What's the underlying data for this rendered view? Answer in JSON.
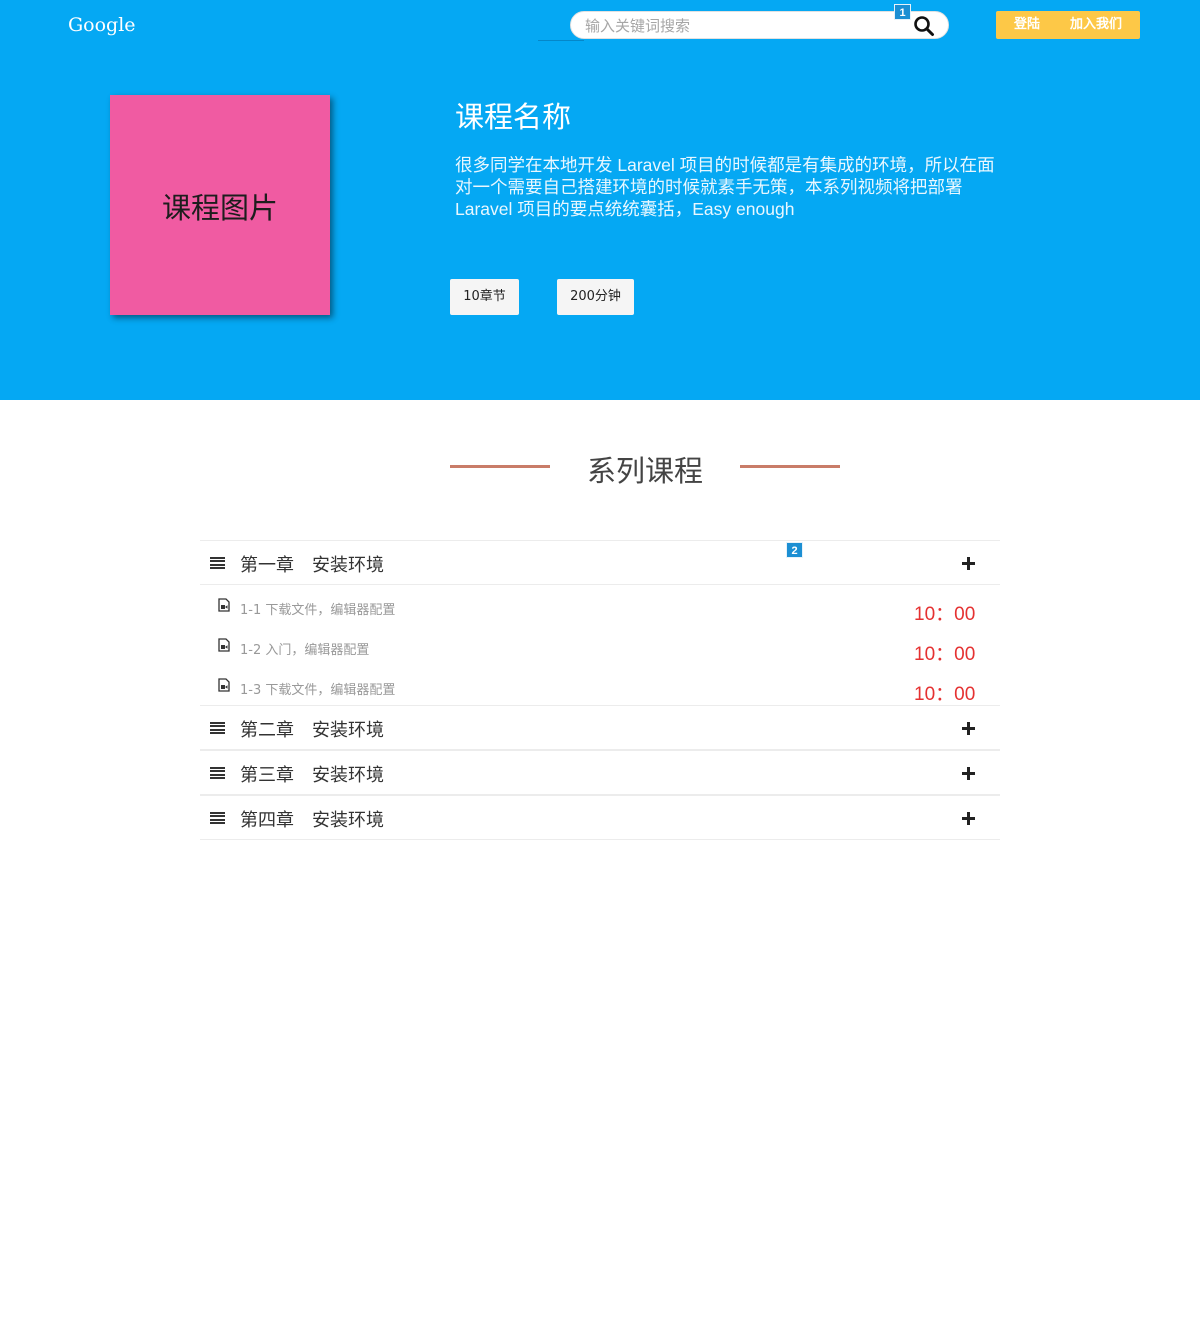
{
  "header": {
    "logo": "Google",
    "search_placeholder": "输入关键词搜索",
    "search_badge": "1",
    "login_label": "登陆",
    "join_label": "加入我们"
  },
  "course": {
    "image_label": "课程图片",
    "title": "课程名称",
    "description": "很多同学在本地开发 Laravel 项目的时候都是有集成的环境，所以在面对一个需要自己搭建环境的时候就素手无策，本系列视频将把部署 Laravel 项目的要点统统囊括，Easy enough",
    "chapters_tag": "10章节",
    "minutes_tag": "200分钟"
  },
  "series": {
    "title": "系列课程",
    "chapter_badge": "2",
    "chapters": [
      {
        "title": "第一章　安装环境",
        "lessons": [
          {
            "title": "1-1 下载文件，编辑器配置",
            "time": "10：00"
          },
          {
            "title": "1-2 入门，编辑器配置",
            "time": "10：00"
          },
          {
            "title": "1-3 下载文件，编辑器配置",
            "time": "10：00"
          }
        ]
      },
      {
        "title": "第二章　安装环境"
      },
      {
        "title": "第三章　安装环境"
      },
      {
        "title": "第四章　安装环境"
      }
    ]
  },
  "colors": {
    "hero_bg": "#05a8f3",
    "course_image_bg": "#f05ba2",
    "button_bg": "#fdc847",
    "time_red": "#e53131",
    "title_line": "#c97c68"
  },
  "icons": {
    "search": "search-icon",
    "menu": "menu-icon",
    "plus": "plus-icon",
    "file": "video-file-icon"
  }
}
